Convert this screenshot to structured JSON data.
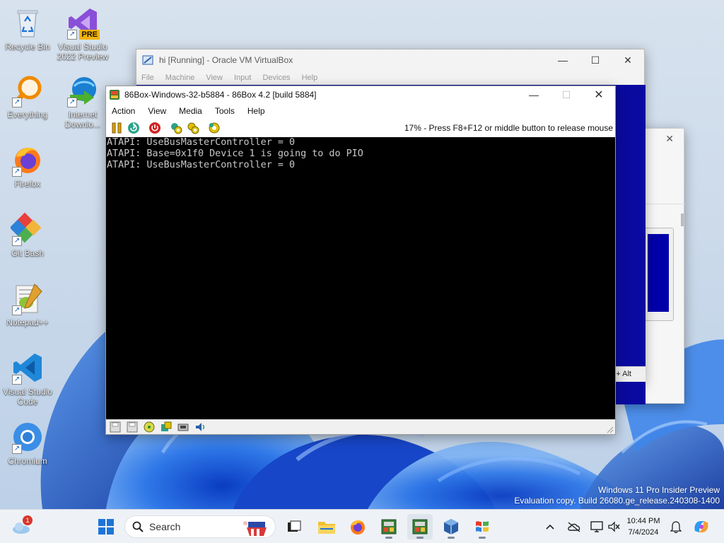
{
  "desktop": {
    "icons": [
      {
        "label": "Recycle Bin",
        "icon": "recycle-bin-icon"
      },
      {
        "label": "Visual Studio 2022 Preview",
        "icon": "visual-studio-icon",
        "badge": "PRE"
      },
      {
        "label": "Everything",
        "icon": "everything-search-icon"
      },
      {
        "label": "Internet Downlo...",
        "icon": "internet-download-manager-icon"
      },
      {
        "label": "Firefox",
        "icon": "firefox-icon"
      },
      {
        "label": "Git Bash",
        "icon": "git-bash-icon"
      },
      {
        "label": "Notepad++",
        "icon": "notepad-plus-plus-icon"
      },
      {
        "label": "Visual Studio Code",
        "icon": "vscode-icon"
      },
      {
        "label": "Chromium",
        "icon": "chromium-icon"
      }
    ],
    "watermark_line1": "Windows 11 Pro Insider Preview",
    "watermark_line2": "Evaluation copy. Build 26080.ge_release.240308-1400"
  },
  "vbox": {
    "title": "hi [Running] - Oracle VM VirtualBox",
    "menu": [
      "File",
      "Machine",
      "View",
      "Input",
      "Devices",
      "Help"
    ],
    "status_hint": "+ Alt"
  },
  "box86": {
    "title": "86Box-Windows-32-b5884 - 86Box 4.2 [build 5884]",
    "menu": [
      "Action",
      "View",
      "Media",
      "Tools",
      "Help"
    ],
    "status": "17% - Press F8+F12 or middle button to release mouse",
    "console_lines": [
      "ATAPI: UseBusMasterController = 0",
      "ATAPI: Base=0x1f0 Device 1 is going to do PIO",
      "ATAPI: UseBusMasterController = 0"
    ]
  },
  "taskbar": {
    "search_label": "Search",
    "weather_badge": "1",
    "time": "10:44 PM",
    "date": "7/4/2024"
  },
  "colors": {
    "vbox_screen": "#0a0aa0",
    "console_bg": "#000000",
    "console_fg": "#c8c8c8",
    "wallpaper_swirl": "#1f5fd6"
  }
}
